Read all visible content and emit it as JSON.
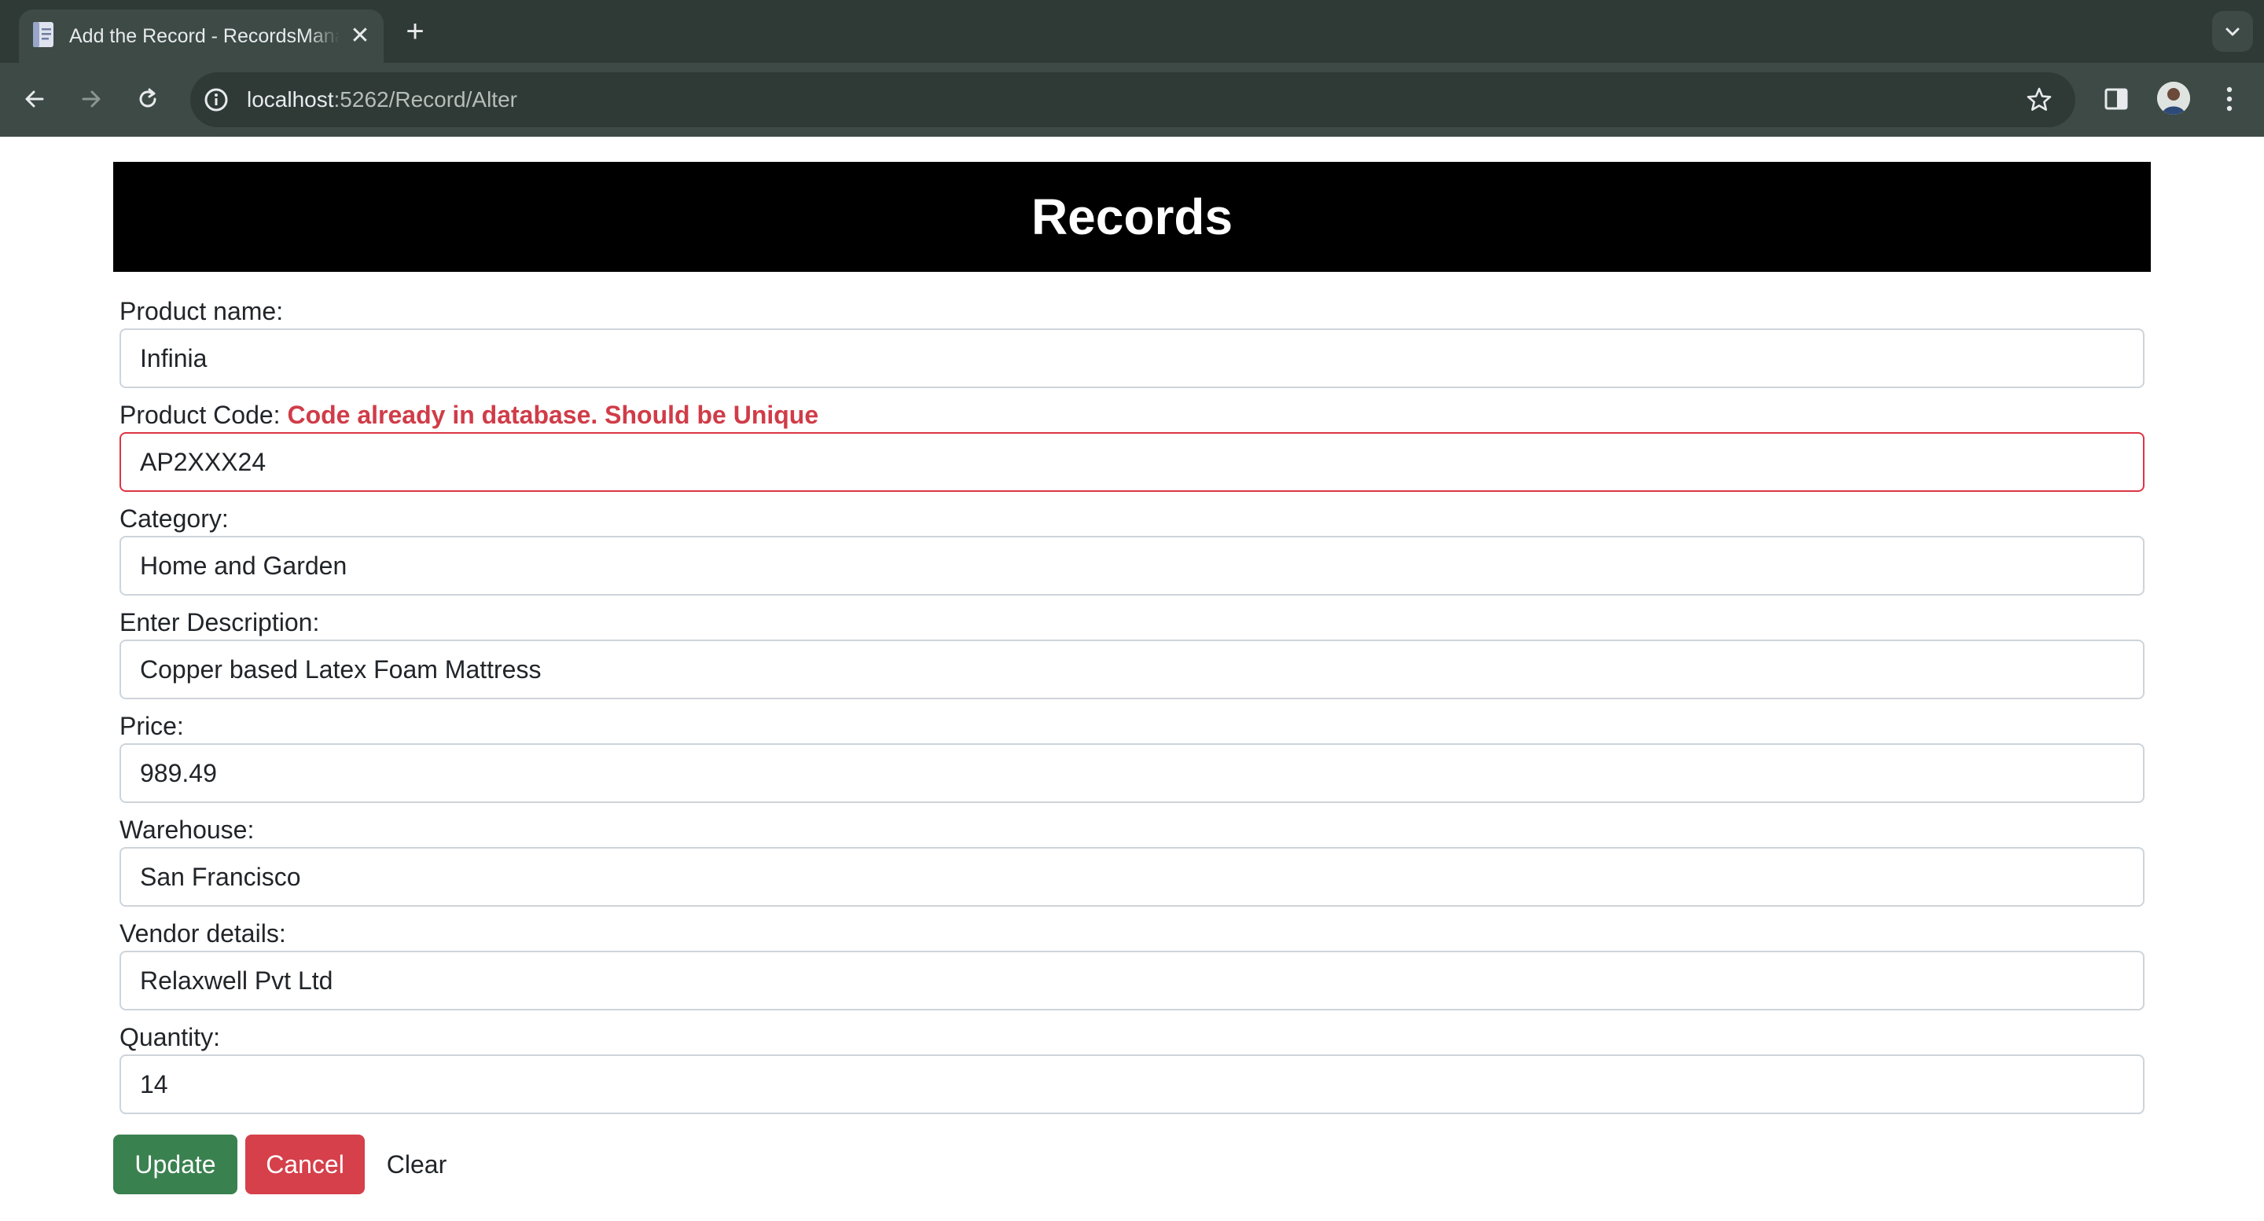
{
  "browser": {
    "tab_title": "Add the Record - RecordsManager",
    "new_tab_symbol": "+",
    "close_symbol": "✕",
    "url_host": "localhost",
    "url_path": ":5262/Record/Alter"
  },
  "page": {
    "header_title": "Records"
  },
  "form": {
    "product_name": {
      "label": "Product name:",
      "value": "Infinia"
    },
    "product_code": {
      "label": "Product Code:",
      "error": "Code already in database. Should be Unique",
      "value": "AP2XXX24"
    },
    "category": {
      "label": "Category:",
      "value": "Home and Garden"
    },
    "description": {
      "label": "Enter Description:",
      "value": "Copper based Latex Foam Mattress"
    },
    "price": {
      "label": "Price:",
      "value": "989.49"
    },
    "warehouse": {
      "label": "Warehouse:",
      "value": "San Francisco"
    },
    "vendor": {
      "label": "Vendor details:",
      "value": "Relaxwell Pvt Ltd"
    },
    "quantity": {
      "label": "Quantity:",
      "value": "14"
    }
  },
  "actions": {
    "update_label": "Update",
    "cancel_label": "Cancel",
    "clear_label": "Clear"
  },
  "colors": {
    "error": "#d03c48",
    "update_button": "#3a8150",
    "cancel_button": "#d5404b",
    "header_bg": "#000000"
  }
}
